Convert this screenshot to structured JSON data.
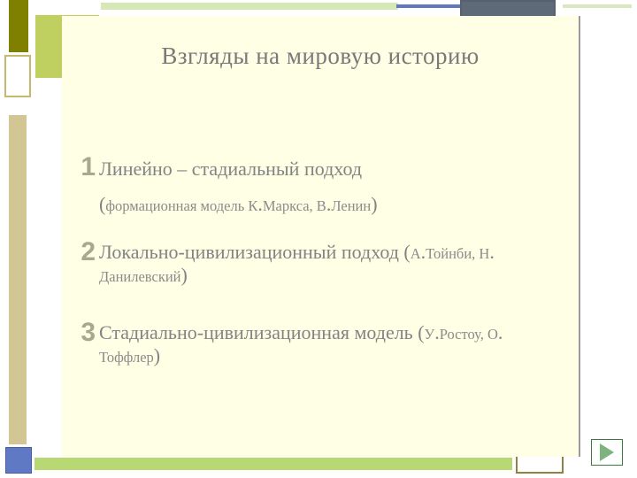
{
  "title": "Взгляды на мировую историю",
  "items": [
    {
      "num": "1",
      "main": "Линейно – стадиальный   подход",
      "sub_open": "(",
      "sub_body": "формационная модель К",
      "sub_mid1": ".",
      "sub_body2": "Маркса, В",
      "sub_mid2": ".",
      "sub_body3": "Ленин",
      "sub_close": ")"
    },
    {
      "num": "2",
      "line1_big1": "Локально-цивилизационный подход ",
      "line1_sm_open": "(",
      "line1_sm1": "А",
      "line1_dot1": ".",
      "line1_sm2": "Тойнби, Н",
      "line1_dot2": ".",
      "line2_sm": "Данилевский",
      "line2_close": ")"
    },
    {
      "num": "3",
      "line1_big1": "Стадиально-цивилизационная модель ",
      "line1_sm_open": "(",
      "line1_sm1": "У",
      "line1_dot1": ".",
      "line1_sm2": "Ростоу, О",
      "line1_dot2": ".",
      "line2_sm": "Тоффлер",
      "line2_close": ")"
    }
  ],
  "nav": {
    "forward_label": "Next"
  },
  "colors": {
    "panel_bg": "#feffe4",
    "accent_olive": "#808000",
    "accent_lime": "#c0d060",
    "accent_blue": "#5f79c4"
  }
}
